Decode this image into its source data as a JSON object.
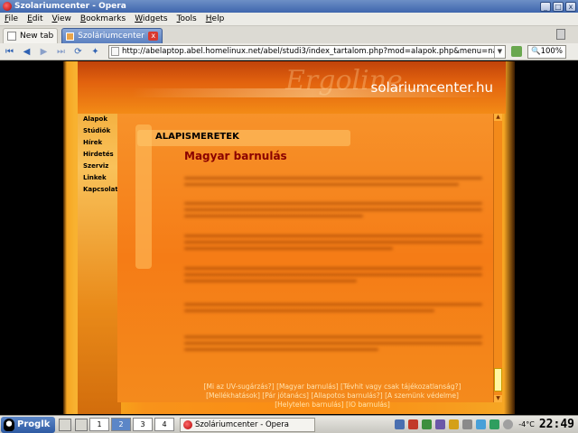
{
  "window": {
    "title": "Szolariumcenter - Opera"
  },
  "menu": [
    {
      "label": "File",
      "u": "F",
      "rest": "ile"
    },
    {
      "label": "Edit",
      "u": "E",
      "rest": "dit"
    },
    {
      "label": "View",
      "u": "V",
      "rest": "iew"
    },
    {
      "label": "Bookmarks",
      "u": "B",
      "rest": "ookmarks"
    },
    {
      "label": "Widgets",
      "u": "W",
      "rest": "idgets"
    },
    {
      "label": "Tools",
      "u": "T",
      "rest": "ools"
    },
    {
      "label": "Help",
      "u": "H",
      "rest": "elp"
    }
  ],
  "tabs": {
    "new_tab_label": "New tab",
    "active_tab_label": "Szoláriumcenter",
    "close_glyph": "x"
  },
  "address": {
    "url": "http://abelaptop.abel.homelinux.net/abel/studi3/index_tartalom.php?mod=alapok.php&menu=napos.jpg",
    "zoom": "100%"
  },
  "site": {
    "title": "solariumcenter.hu",
    "logo_script": "Ergoline",
    "nav": [
      "Alapok",
      "Stúdiók",
      "Hírek",
      "Hirdetés",
      "Szerviz",
      "Linkek",
      "Kapcsolat"
    ],
    "section_title": "ALAPISMERETEK",
    "page_title": "Magyar barnulás",
    "footer_links": [
      "[Mi az UV-sugárzás?]",
      "[Magyar barnulás]",
      "[Tévhit vagy csak tájékozatlanság?]",
      "[Mellékhatások]",
      "[Pár jótanács]",
      "[Allapotos barnulás?]",
      "[A szemünk védelme]",
      "[Helytelen barnulás]",
      "[IO barnulás]"
    ]
  },
  "taskbar": {
    "start_label": "Proglk",
    "desktops": [
      "1",
      "2",
      "3",
      "4"
    ],
    "active_desktop": "2",
    "task_label": "Szoláriumcenter - Opera",
    "temperature": "-4°C",
    "clock": "22:49"
  }
}
